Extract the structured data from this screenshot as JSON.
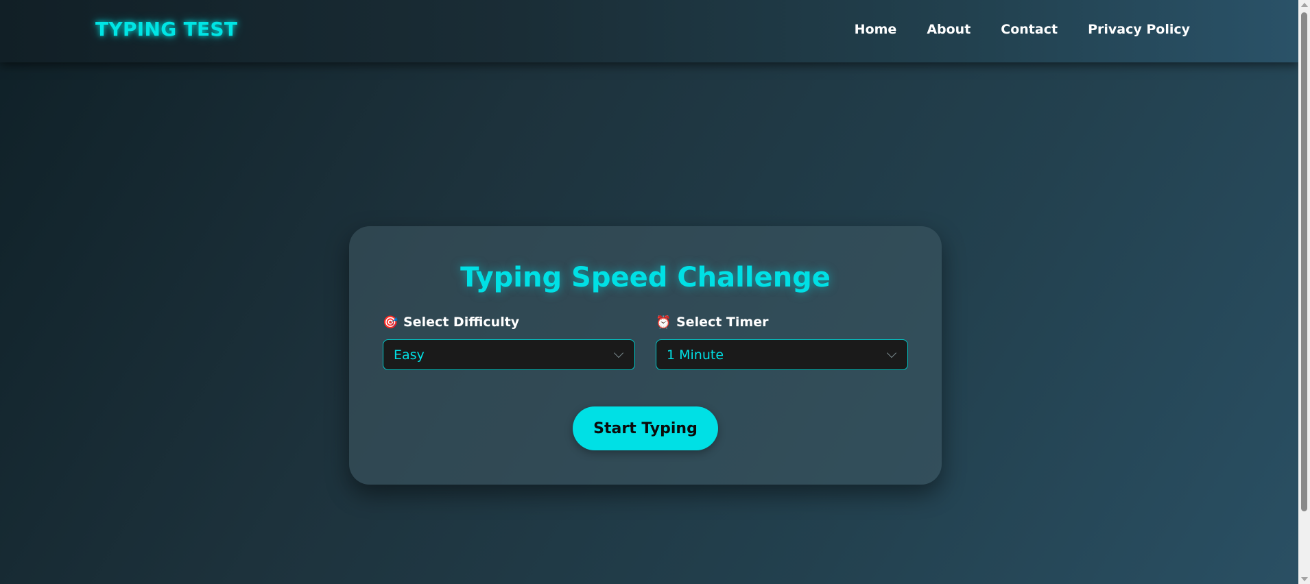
{
  "header": {
    "logo": "TYPING TEST",
    "nav": [
      {
        "label": "Home"
      },
      {
        "label": "About"
      },
      {
        "label": "Contact"
      },
      {
        "label": "Privacy Policy"
      }
    ]
  },
  "card": {
    "title": "Typing Speed Challenge",
    "difficulty": {
      "icon": "🎯",
      "icon_name": "target-icon",
      "label": "Select Difficulty",
      "selected": "Easy"
    },
    "timer": {
      "icon": "⏰",
      "icon_name": "alarm-clock-icon",
      "label": "Select Timer",
      "selected": "1 Minute"
    },
    "start_button": "Start Typing"
  },
  "colors": {
    "accent": "#00e0e5",
    "select_bg": "#1a1a1a",
    "text": "#ffffff"
  }
}
